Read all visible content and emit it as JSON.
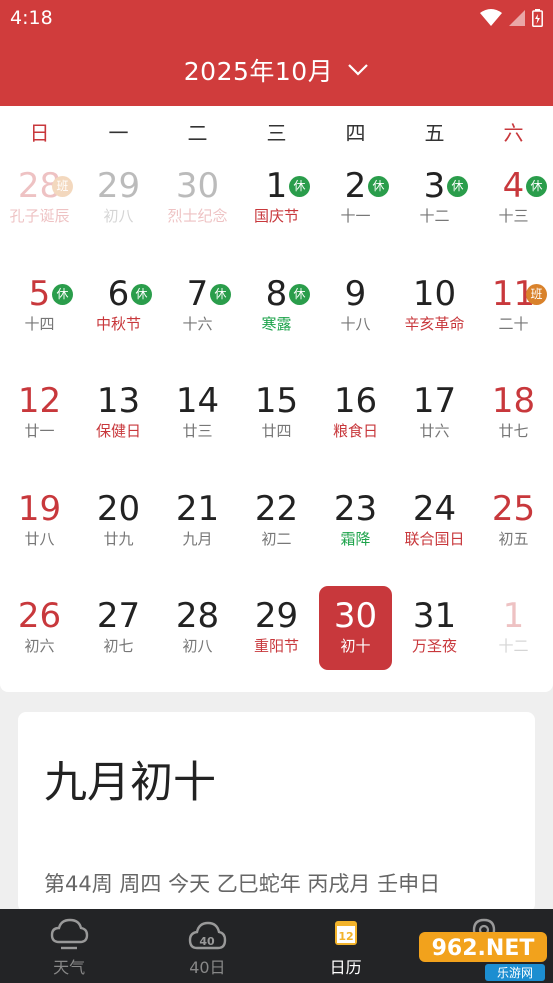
{
  "status_bar": {
    "time": "4:18"
  },
  "header": {
    "title": "2025年10月"
  },
  "weekdays": [
    "日",
    "一",
    "二",
    "三",
    "四",
    "五",
    "六"
  ],
  "days": [
    {
      "num": "28",
      "sub": "孔子诞辰",
      "other": true,
      "festival": true,
      "weekend": true,
      "badge": "班"
    },
    {
      "num": "29",
      "sub": "初八",
      "other": true
    },
    {
      "num": "30",
      "sub": "烈士纪念",
      "other": true,
      "festival": true
    },
    {
      "num": "1",
      "sub": "国庆节",
      "festival": true,
      "badge": "休"
    },
    {
      "num": "2",
      "sub": "十一",
      "badge": "休"
    },
    {
      "num": "3",
      "sub": "十二",
      "badge": "休"
    },
    {
      "num": "4",
      "sub": "十三",
      "weekend": true,
      "badge": "休"
    },
    {
      "num": "5",
      "sub": "十四",
      "weekend": true,
      "badge": "休"
    },
    {
      "num": "6",
      "sub": "中秋节",
      "festival": true,
      "badge": "休"
    },
    {
      "num": "7",
      "sub": "十六",
      "badge": "休"
    },
    {
      "num": "8",
      "sub": "寒露",
      "term": true,
      "badge": "休"
    },
    {
      "num": "9",
      "sub": "十八"
    },
    {
      "num": "10",
      "sub": "辛亥革命",
      "festival": true
    },
    {
      "num": "11",
      "sub": "二十",
      "weekend": true,
      "badge": "班"
    },
    {
      "num": "12",
      "sub": "廿一",
      "weekend": true
    },
    {
      "num": "13",
      "sub": "保健日",
      "festival": true
    },
    {
      "num": "14",
      "sub": "廿三"
    },
    {
      "num": "15",
      "sub": "廿四"
    },
    {
      "num": "16",
      "sub": "粮食日",
      "festival": true
    },
    {
      "num": "17",
      "sub": "廿六"
    },
    {
      "num": "18",
      "sub": "廿七",
      "weekend": true
    },
    {
      "num": "19",
      "sub": "廿八",
      "weekend": true
    },
    {
      "num": "20",
      "sub": "廿九"
    },
    {
      "num": "21",
      "sub": "九月"
    },
    {
      "num": "22",
      "sub": "初二"
    },
    {
      "num": "23",
      "sub": "霜降",
      "term": true
    },
    {
      "num": "24",
      "sub": "联合国日",
      "festival": true
    },
    {
      "num": "25",
      "sub": "初五",
      "weekend": true
    },
    {
      "num": "26",
      "sub": "初六",
      "weekend": true
    },
    {
      "num": "27",
      "sub": "初七"
    },
    {
      "num": "28",
      "sub": "初八"
    },
    {
      "num": "29",
      "sub": "重阳节",
      "festival": true
    },
    {
      "num": "30",
      "sub": "初十",
      "selected": true
    },
    {
      "num": "31",
      "sub": "万圣夜",
      "festival": true
    },
    {
      "num": "1",
      "sub": "十二",
      "other": true,
      "weekend": true
    }
  ],
  "lunar_card": {
    "title": "九月初十",
    "info": "第44周 周四 今天 乙巳蛇年 丙戌月 壬申日"
  },
  "tabs": [
    {
      "label": "天气",
      "icon": "cloud-icon"
    },
    {
      "label": "40日",
      "icon": "cloud-40-icon",
      "icon_text": "40"
    },
    {
      "label": "日历",
      "icon": "calendar-icon",
      "icon_text": "12",
      "active": true
    },
    {
      "label": "",
      "icon": "location-icon"
    }
  ],
  "watermark": {
    "text": "962.NET",
    "sub": "乐游网"
  },
  "colors": {
    "brand_red": "#d03c3c",
    "holiday_green": "#2a9d4b",
    "workday_orange": "#d9822b",
    "term_green": "#1ea34b"
  }
}
